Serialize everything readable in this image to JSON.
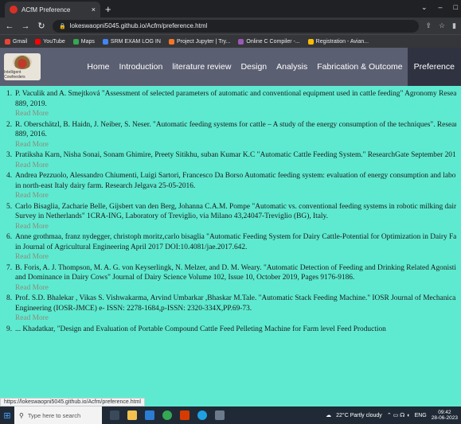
{
  "browser": {
    "tab_title": "ACfM Preference",
    "tab_close": "×",
    "new_tab": "+",
    "url": "lokeswaopni5045.github.io/Acfm/preference.html",
    "bookmarks": [
      {
        "label": "Gmail",
        "color": "#ea4335"
      },
      {
        "label": "YouTube",
        "color": "#ff0000"
      },
      {
        "label": "Maps",
        "color": "#34a853"
      },
      {
        "label": "SRM EXAM LOG IN",
        "color": "#4285f4"
      },
      {
        "label": "Project Jupyter | Try...",
        "color": "#f37726"
      },
      {
        "label": "Online C Compiler -...",
        "color": "#9b59b6"
      },
      {
        "label": "Registration - Avian...",
        "color": "#fbbc05"
      }
    ]
  },
  "site": {
    "logo_text": "Intelligent Cowfeeders",
    "nav": [
      "Home",
      "Introduction",
      "literature review",
      "Design",
      "Analysis",
      "Fabrication & Outcome",
      "Preference"
    ]
  },
  "references": [
    {
      "num": "1.",
      "lines": [
        "P. Vaculik and A. Smejtková \"Assessment of selected parameters of automatic and conventional equipment used in cattle feeding\" Agronomy Research 17(3),",
        "889, 2019."
      ]
    },
    {
      "num": "2.",
      "lines": [
        "R. Oberschätzl, B. Haidn, J. Neiber, S. Neser. \"Automatic feeding systems for cattle – A study of the energy consumption of the techniques\". Research 12(2), 9",
        "889, 2016."
      ]
    },
    {
      "num": "3.",
      "lines": [
        "Pratiksha Karn, Nisha Sonai, Sonam Ghimire, Preety Sitikhu, suban Kumar K.C \"Automatic Cattle Feeding System.\" ResearchGate September 2019."
      ]
    },
    {
      "num": "4.",
      "lines": [
        "Andrea Pezzuolo, Alessandro Chiumenti, Luigi Sartori, Francesco Da Borso Automatic feeding system: evaluation of energy consumption and labour requiren",
        "in north-east Italy dairy farm. Research Jelgava 25-05-2016."
      ]
    },
    {
      "num": "5.",
      "lines": [
        "Carlo Bisaglia, Zacharie Belle, Gijsbert van den Berg, Johanna C.A.M. Pompe \"Automatic vs. conventional feeding systems in robotic milking dairy farms: a",
        "Survey in Netherlands\" 1CRA-ING, Laboratory of Treviglio, via Milano 43,24047-Treviglio (BG), Italy."
      ]
    },
    {
      "num": "6.",
      "lines": [
        "Anne grothmaa, franz nydegger, christoph moritz,carlo bisaglia \"Automatic Feeding System for Dairy Cattle-Potential for Optimization in Dairy Farming\" Ar",
        "in Journal of Agricultural Engineering April 2017 DOI:10.4081/jae.2017.642."
      ]
    },
    {
      "num": "7.",
      "lines": [
        "B. Foris, A. J. Thompson, M. A. G. von Keyserlingk, N. Melzer, and D. M. Weary. \"Automatic Detection of Feeding and Drinking Related Agonistic Behaviou",
        "and Dominance in Dairy Cows\" Journal of Dairy Science Volume 102, Issue 10, October 2019, Pages 9176-9186."
      ]
    },
    {
      "num": "8.",
      "lines": [
        "Prof. S.D. Bhalekar , Vikas S. Vishwakarma, Arvind Umbarkar ,Bhaskar M.Tale. \"Automatic Stack Feeding Machine.\" IOSR Journal of Mechanical and Civil",
        "Engineering (IOSR-JMCE) e- ISSN: 2278-1684,p-ISSN: 2320-334X,PP.69-73."
      ]
    },
    {
      "num": "9.",
      "lines": [
        "... Khadatkar, \"Design and Evaluation of Portable Compound Cattle Feed Pelleting Machine for Farm level Feed Production"
      ]
    }
  ],
  "read_more_label": "Read More",
  "status_url": "https://lokeswaopni5045.github.io/Acfm/preference.html",
  "taskbar": {
    "search_placeholder": "Type here to search",
    "weather": "22°C Partly cloudy",
    "lang": "ENG",
    "time": "09:42",
    "date": "28-06-2023"
  }
}
